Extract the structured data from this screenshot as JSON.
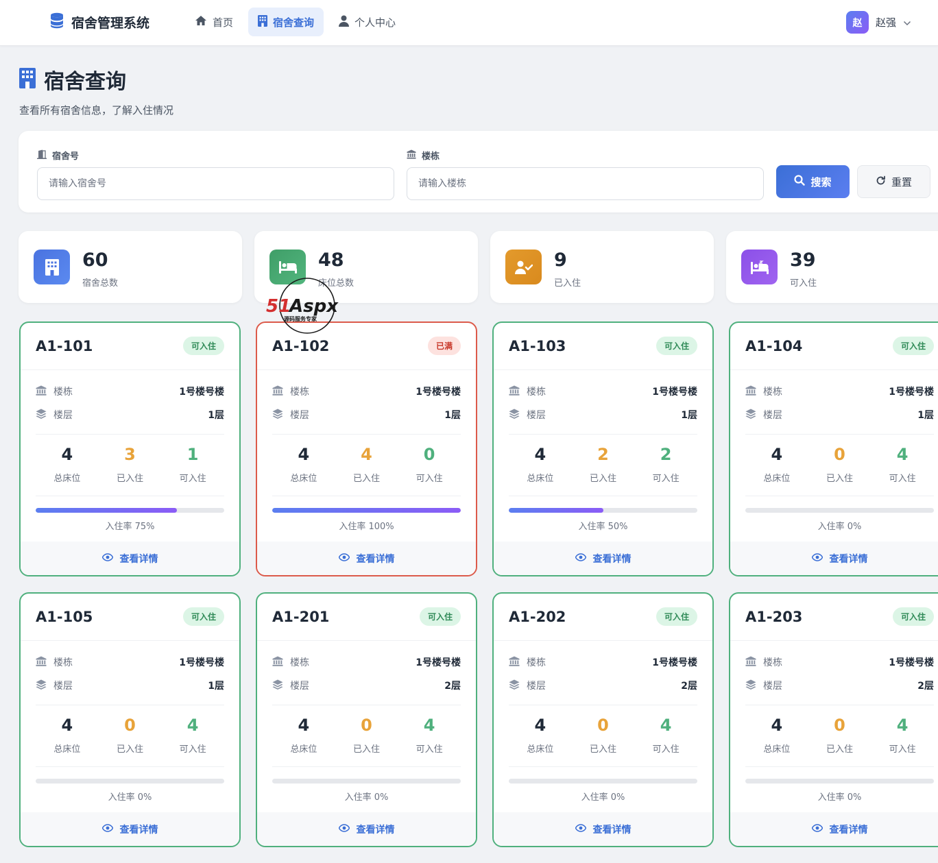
{
  "header": {
    "brand": "宿舍管理系统",
    "nav": [
      {
        "label": "首页",
        "icon": "home-icon"
      },
      {
        "label": "宿舍查询",
        "icon": "building-icon",
        "active": true
      },
      {
        "label": "个人中心",
        "icon": "user-icon"
      }
    ],
    "user": {
      "avatar": "赵",
      "name": "赵强"
    }
  },
  "page": {
    "title": "宿舍查询",
    "subtitle": "查看所有宿舍信息，了解入住情况"
  },
  "search": {
    "room_label": "宿舍号",
    "room_placeholder": "请输入宿舍号",
    "building_label": "楼栋",
    "building_placeholder": "请输入楼栋",
    "search_button": "搜索",
    "reset_button": "重置"
  },
  "stats": [
    {
      "value": "60",
      "label": "宿舍总数",
      "color": "#4a73e0"
    },
    {
      "value": "48",
      "label": "床位总数",
      "color": "#43a86f"
    },
    {
      "value": "9",
      "label": "已入住",
      "color": "#e39a2c"
    },
    {
      "value": "39",
      "label": "可入住",
      "color": "#8b50e8"
    }
  ],
  "labels": {
    "building": "楼栋",
    "floor": "楼层",
    "total_beds": "总床位",
    "occupied": "已入住",
    "available": "可入住",
    "detail": "查看详情"
  },
  "rooms": [
    {
      "no": "A1-101",
      "status": "可入住",
      "full": false,
      "building": "1号楼号楼",
      "floor": "1层",
      "total": "4",
      "occupied": "3",
      "available": "1",
      "rate_text": "入住率 75%",
      "rate": 0.75
    },
    {
      "no": "A1-102",
      "status": "已满",
      "full": true,
      "building": "1号楼号楼",
      "floor": "1层",
      "total": "4",
      "occupied": "4",
      "available": "0",
      "rate_text": "入住率 100%",
      "rate": 1.0
    },
    {
      "no": "A1-103",
      "status": "可入住",
      "full": false,
      "building": "1号楼号楼",
      "floor": "1层",
      "total": "4",
      "occupied": "2",
      "available": "2",
      "rate_text": "入住率 50%",
      "rate": 0.5
    },
    {
      "no": "A1-104",
      "status": "可入住",
      "full": false,
      "building": "1号楼号楼",
      "floor": "1层",
      "total": "4",
      "occupied": "0",
      "available": "4",
      "rate_text": "入住率 0%",
      "rate": 0
    },
    {
      "no": "A1-105",
      "status": "可入住",
      "full": false,
      "building": "1号楼号楼",
      "floor": "1层",
      "total": "4",
      "occupied": "0",
      "available": "4",
      "rate_text": "入住率 0%",
      "rate": 0
    },
    {
      "no": "A1-201",
      "status": "可入住",
      "full": false,
      "building": "1号楼号楼",
      "floor": "2层",
      "total": "4",
      "occupied": "0",
      "available": "4",
      "rate_text": "入住率 0%",
      "rate": 0
    },
    {
      "no": "A1-202",
      "status": "可入住",
      "full": false,
      "building": "1号楼号楼",
      "floor": "2层",
      "total": "4",
      "occupied": "0",
      "available": "4",
      "rate_text": "入住率 0%",
      "rate": 0
    },
    {
      "no": "A1-203",
      "status": "可入住",
      "full": false,
      "building": "1号楼号楼",
      "floor": "2层",
      "total": "4",
      "occupied": "0",
      "available": "4",
      "rate_text": "入住率 0%",
      "rate": 0
    }
  ],
  "watermark": {
    "text": "51Aspx",
    "sub": "源码服务专家"
  }
}
